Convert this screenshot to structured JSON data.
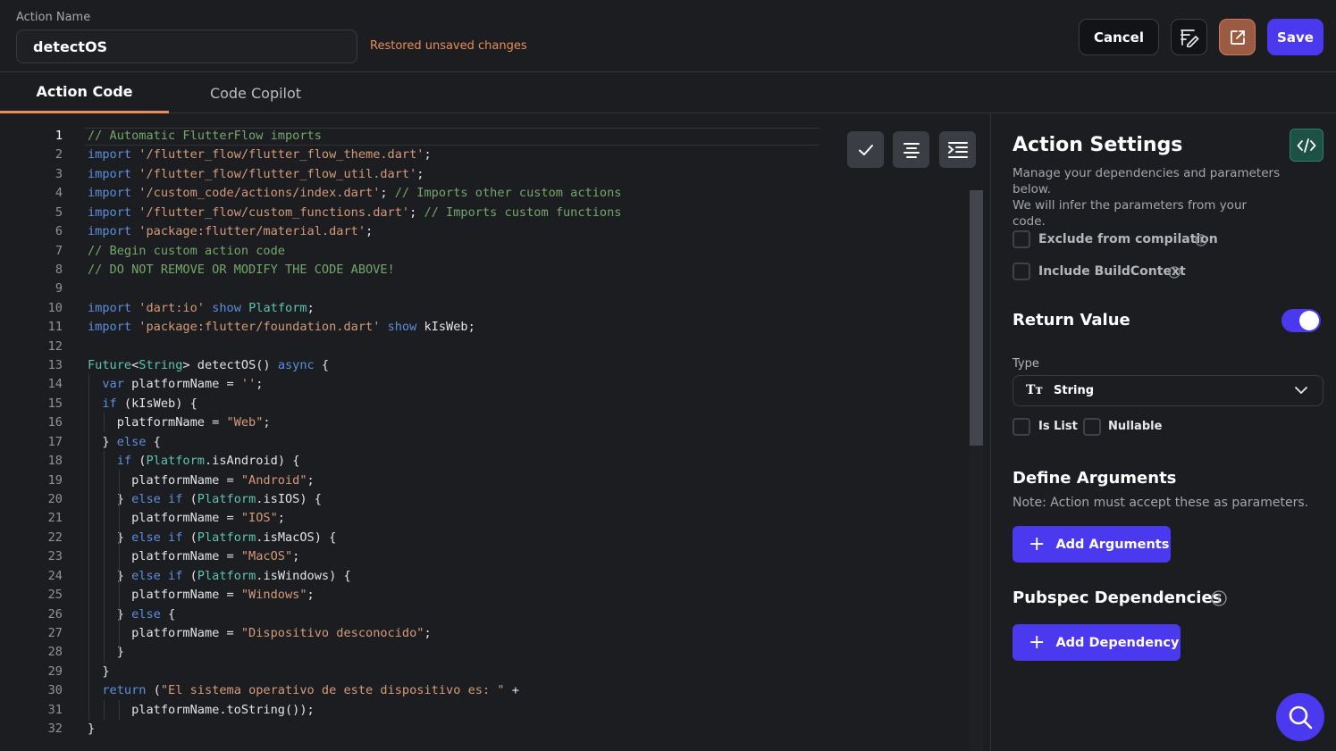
{
  "header": {
    "action_name_label": "Action Name",
    "action_name_value": "detectOS",
    "restore_note": "Restored unsaved changes",
    "cancel_label": "Cancel",
    "save_label": "Save"
  },
  "tabs": [
    {
      "label": "Action Code",
      "active": true
    },
    {
      "label": "Code Copilot",
      "active": false
    }
  ],
  "code": {
    "lines": [
      {
        "n": "1",
        "tokens": [
          {
            "t": "// Automatic FlutterFlow imports",
            "c": "com"
          }
        ]
      },
      {
        "n": "2",
        "tokens": [
          {
            "t": "import ",
            "c": "kw"
          },
          {
            "t": "'/flutter_flow/flutter_flow_theme.dart'",
            "c": "str"
          },
          {
            "t": ";",
            "c": ""
          }
        ]
      },
      {
        "n": "3",
        "tokens": [
          {
            "t": "import ",
            "c": "kw"
          },
          {
            "t": "'/flutter_flow/flutter_flow_util.dart'",
            "c": "str"
          },
          {
            "t": ";",
            "c": ""
          }
        ]
      },
      {
        "n": "4",
        "tokens": [
          {
            "t": "import ",
            "c": "kw"
          },
          {
            "t": "'/custom_code/actions/index.dart'",
            "c": "str"
          },
          {
            "t": "; ",
            "c": ""
          },
          {
            "t": "// Imports other custom actions",
            "c": "com"
          }
        ]
      },
      {
        "n": "5",
        "tokens": [
          {
            "t": "import ",
            "c": "kw"
          },
          {
            "t": "'/flutter_flow/custom_functions.dart'",
            "c": "str"
          },
          {
            "t": "; ",
            "c": ""
          },
          {
            "t": "// Imports custom functions",
            "c": "com"
          }
        ]
      },
      {
        "n": "6",
        "tokens": [
          {
            "t": "import ",
            "c": "kw"
          },
          {
            "t": "'package:flutter/material.dart'",
            "c": "str"
          },
          {
            "t": ";",
            "c": ""
          }
        ]
      },
      {
        "n": "7",
        "tokens": [
          {
            "t": "// Begin custom action code",
            "c": "com"
          }
        ]
      },
      {
        "n": "8",
        "tokens": [
          {
            "t": "// DO NOT REMOVE OR MODIFY THE CODE ABOVE!",
            "c": "com"
          }
        ]
      },
      {
        "n": "9",
        "tokens": []
      },
      {
        "n": "10",
        "tokens": [
          {
            "t": "import ",
            "c": "kw"
          },
          {
            "t": "'dart:io'",
            "c": "str"
          },
          {
            "t": " ",
            "c": ""
          },
          {
            "t": "show",
            "c": "kw"
          },
          {
            "t": " ",
            "c": ""
          },
          {
            "t": "Platform",
            "c": "typ"
          },
          {
            "t": ";",
            "c": ""
          }
        ]
      },
      {
        "n": "11",
        "tokens": [
          {
            "t": "import ",
            "c": "kw"
          },
          {
            "t": "'package:flutter/foundation.dart'",
            "c": "str"
          },
          {
            "t": " ",
            "c": ""
          },
          {
            "t": "show",
            "c": "kw"
          },
          {
            "t": " kIsWeb;",
            "c": ""
          }
        ]
      },
      {
        "n": "12",
        "tokens": []
      },
      {
        "n": "13",
        "tokens": [
          {
            "t": "Future",
            "c": "typ"
          },
          {
            "t": "<",
            "c": ""
          },
          {
            "t": "String",
            "c": "typ"
          },
          {
            "t": "> detectOS() ",
            "c": ""
          },
          {
            "t": "async",
            "c": "kw"
          },
          {
            "t": " {",
            "c": ""
          }
        ]
      },
      {
        "n": "14",
        "tokens": [
          {
            "t": "  ",
            "c": ""
          },
          {
            "t": "var",
            "c": "kw"
          },
          {
            "t": " platformName = ",
            "c": ""
          },
          {
            "t": "''",
            "c": "str"
          },
          {
            "t": ";",
            "c": ""
          }
        ]
      },
      {
        "n": "15",
        "tokens": [
          {
            "t": "  ",
            "c": ""
          },
          {
            "t": "if",
            "c": "kw"
          },
          {
            "t": " (kIsWeb) {",
            "c": ""
          }
        ]
      },
      {
        "n": "16",
        "tokens": [
          {
            "t": "    platformName = ",
            "c": ""
          },
          {
            "t": "\"Web\"",
            "c": "str"
          },
          {
            "t": ";",
            "c": ""
          }
        ]
      },
      {
        "n": "17",
        "tokens": [
          {
            "t": "  } ",
            "c": ""
          },
          {
            "t": "else",
            "c": "kw"
          },
          {
            "t": " {",
            "c": ""
          }
        ]
      },
      {
        "n": "18",
        "tokens": [
          {
            "t": "    ",
            "c": ""
          },
          {
            "t": "if",
            "c": "kw"
          },
          {
            "t": " (",
            "c": ""
          },
          {
            "t": "Platform",
            "c": "typ"
          },
          {
            "t": ".isAndroid) {",
            "c": ""
          }
        ]
      },
      {
        "n": "19",
        "tokens": [
          {
            "t": "      platformName = ",
            "c": ""
          },
          {
            "t": "\"Android\"",
            "c": "str"
          },
          {
            "t": ";",
            "c": ""
          }
        ]
      },
      {
        "n": "20",
        "tokens": [
          {
            "t": "    } ",
            "c": ""
          },
          {
            "t": "else if",
            "c": "kw"
          },
          {
            "t": " (",
            "c": ""
          },
          {
            "t": "Platform",
            "c": "typ"
          },
          {
            "t": ".isIOS) {",
            "c": ""
          }
        ]
      },
      {
        "n": "21",
        "tokens": [
          {
            "t": "      platformName = ",
            "c": ""
          },
          {
            "t": "\"IOS\"",
            "c": "str"
          },
          {
            "t": ";",
            "c": ""
          }
        ]
      },
      {
        "n": "22",
        "tokens": [
          {
            "t": "    } ",
            "c": ""
          },
          {
            "t": "else if",
            "c": "kw"
          },
          {
            "t": " (",
            "c": ""
          },
          {
            "t": "Platform",
            "c": "typ"
          },
          {
            "t": ".isMacOS) {",
            "c": ""
          }
        ]
      },
      {
        "n": "23",
        "tokens": [
          {
            "t": "      platformName = ",
            "c": ""
          },
          {
            "t": "\"MacOS\"",
            "c": "str"
          },
          {
            "t": ";",
            "c": ""
          }
        ]
      },
      {
        "n": "24",
        "tokens": [
          {
            "t": "    } ",
            "c": ""
          },
          {
            "t": "else if",
            "c": "kw"
          },
          {
            "t": " (",
            "c": ""
          },
          {
            "t": "Platform",
            "c": "typ"
          },
          {
            "t": ".isWindows) {",
            "c": ""
          }
        ]
      },
      {
        "n": "25",
        "tokens": [
          {
            "t": "      platformName = ",
            "c": ""
          },
          {
            "t": "\"Windows\"",
            "c": "str"
          },
          {
            "t": ";",
            "c": ""
          }
        ]
      },
      {
        "n": "26",
        "tokens": [
          {
            "t": "    } ",
            "c": ""
          },
          {
            "t": "else",
            "c": "kw"
          },
          {
            "t": " {",
            "c": ""
          }
        ]
      },
      {
        "n": "27",
        "tokens": [
          {
            "t": "      platformName = ",
            "c": ""
          },
          {
            "t": "\"Dispositivo desconocido\"",
            "c": "str"
          },
          {
            "t": ";",
            "c": ""
          }
        ]
      },
      {
        "n": "28",
        "tokens": [
          {
            "t": "    }",
            "c": ""
          }
        ]
      },
      {
        "n": "29",
        "tokens": [
          {
            "t": "  }",
            "c": ""
          }
        ]
      },
      {
        "n": "30",
        "tokens": [
          {
            "t": "  ",
            "c": ""
          },
          {
            "t": "return",
            "c": "kw"
          },
          {
            "t": " (",
            "c": ""
          },
          {
            "t": "\"El sistema operativo de este dispositivo es: \"",
            "c": "str"
          },
          {
            "t": " +",
            "c": ""
          }
        ]
      },
      {
        "n": "31",
        "tokens": [
          {
            "t": "      platformName.toString());",
            "c": ""
          }
        ]
      },
      {
        "n": "32",
        "tokens": [
          {
            "t": "}",
            "c": ""
          }
        ]
      }
    ]
  },
  "settings": {
    "title": "Action Settings",
    "desc_line1": "Manage your dependencies and parameters below.",
    "desc_line2": "We will infer the parameters from your code.",
    "exclude_label": "Exclude from compilation",
    "include_ctx_label": "Include BuildContext",
    "return_value_title": "Return Value",
    "return_value_enabled": true,
    "type_label": "Type",
    "type_glyph": "Tт",
    "type_value": "String",
    "is_list_label": "Is List",
    "nullable_label": "Nullable",
    "define_args_title": "Define Arguments",
    "define_args_note": "Note: Action must accept these as parameters.",
    "add_args_label": "Add Arguments",
    "pubspec_title": "Pubspec Dependencies",
    "add_dep_label": "Add Dependency"
  },
  "colors": {
    "accent": "#4b39ef",
    "warning": "#e88d59",
    "background": "#1b1d20"
  }
}
